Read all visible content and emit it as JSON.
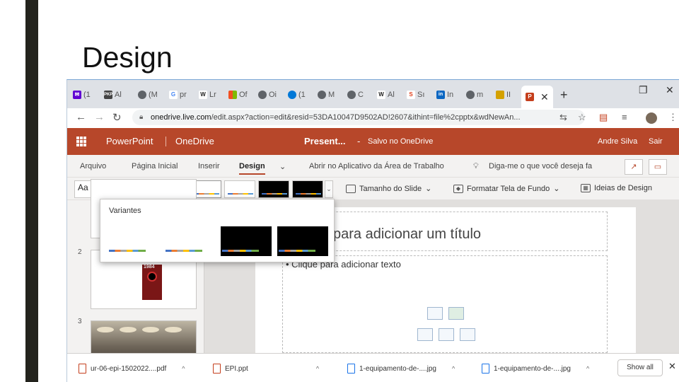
{
  "page": {
    "title": "Design"
  },
  "browser": {
    "tabs": [
      {
        "icon": "yahoo-mail-icon",
        "label": "(1",
        "color": "#6001d2"
      },
      {
        "icon": "pkp-icon",
        "label": "Al",
        "color": "#444444"
      },
      {
        "icon": "globe-icon",
        "label": "(M",
        "color": "#5f6368"
      },
      {
        "icon": "google-icon",
        "label": "pr",
        "color": "#4285f4"
      },
      {
        "icon": "wikipedia-icon",
        "label": "Lr",
        "color": "#222222"
      },
      {
        "icon": "microsoft-icon",
        "label": "Of",
        "color": "#f25022"
      },
      {
        "icon": "globe-icon",
        "label": "Oi",
        "color": "#5f6368"
      },
      {
        "icon": "edge-icon",
        "label": "(1",
        "color": "#0078d7"
      },
      {
        "icon": "globe-icon",
        "label": "M",
        "color": "#5f6368"
      },
      {
        "icon": "globe-icon",
        "label": "C",
        "color": "#5f6368"
      },
      {
        "icon": "wikipedia-icon",
        "label": "Al",
        "color": "#222222"
      },
      {
        "icon": "scribd-icon",
        "label": "Sı",
        "color": "#e03e1a"
      },
      {
        "icon": "linkedin-icon",
        "label": "In",
        "color": "#0a66c2"
      },
      {
        "icon": "globe-icon",
        "label": "m",
        "color": "#5f6368"
      },
      {
        "icon": "bird-icon",
        "label": "II",
        "color": "#d4a100"
      }
    ],
    "active_tab_close": "✕",
    "new_tab": "+",
    "url_host": "onedrive.live.com",
    "url_path": "/edit.aspx?action=edit&resid=53DA10047D9502AD!2607&ithint=file%2cpptx&wdNewAn..."
  },
  "ppt": {
    "app_name": "PowerPoint",
    "service": "OneDrive",
    "doc_name": "Present...",
    "separator": "-",
    "save_status": "Salvo no OneDrive",
    "user_name": "Andre Silva",
    "signout": "Sair",
    "tabs": [
      "Arquivo",
      "Página Inicial",
      "Inserir",
      "Design"
    ],
    "open_desktop": "Abrir no Aplicativo da Área de Trabalho",
    "tell_me": "Diga-me o que você deseja fa",
    "theme_sample": "Aa",
    "slide_size": "Tamanho do Slide",
    "format_bg": "Formatar Tela de Fundo",
    "design_ideas": "Ideias de Design",
    "variants_title": "Variantes",
    "slide_numbers": [
      "2",
      "3"
    ],
    "title_placeholder": "para adicionar um título",
    "body_placeholder": "• Clique para adicionar texto",
    "thumb_book_title": "1984"
  },
  "downloads": {
    "items": [
      {
        "label": "ur-06-epi-1502022....pdf",
        "icon": "pdf-file-icon"
      },
      {
        "label": "EPI.ppt",
        "icon": "ppt-file-icon"
      },
      {
        "label": "1-equipamento-de-....jpg",
        "icon": "image-file-icon"
      },
      {
        "label": "1-equipamento-de-....jpg",
        "icon": "image-file-icon"
      }
    ],
    "show_all": "Show all",
    "close": "✕"
  },
  "colors": {
    "ppt_brand": "#b7472a",
    "chrome_tabstrip": "#dee1e6"
  }
}
